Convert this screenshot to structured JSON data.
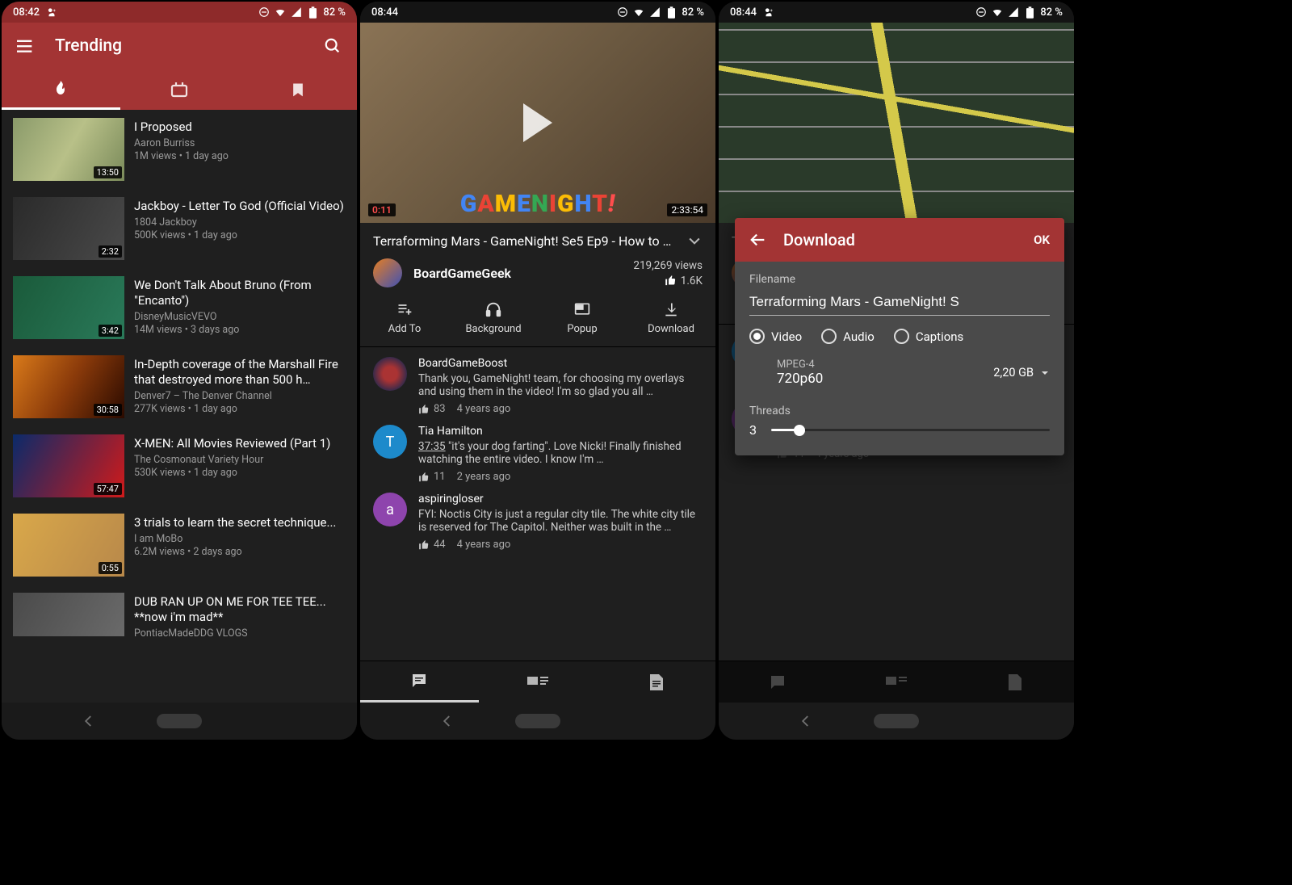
{
  "screens": {
    "s1": {
      "status": {
        "time": "08:42",
        "battery": "82 %"
      },
      "header": {
        "title": "Trending"
      },
      "tabs": [
        "trending",
        "subs",
        "bookmarks"
      ],
      "videos": [
        {
          "title": "I Proposed",
          "channel": "Aaron Burriss",
          "stats": "1M views • 1 day ago",
          "dur": "13:50"
        },
        {
          "title": "Jackboy - Letter To God (Official Video)",
          "channel": "1804 Jackboy",
          "stats": "500K views • 1 day ago",
          "dur": "2:32"
        },
        {
          "title": "We Don't Talk About Bruno (From \"Encanto\")",
          "channel": "DisneyMusicVEVO",
          "stats": "14M views • 3 days ago",
          "dur": "3:42"
        },
        {
          "title": "In-Depth coverage of the Marshall Fire that destroyed more than 500 h…",
          "channel": "Denver7 – The Denver Channel",
          "stats": "277K views • 1 day ago",
          "dur": "30:58"
        },
        {
          "title": "X-MEN: All Movies Reviewed (Part 1)",
          "channel": "The Cosmonaut Variety Hour",
          "stats": "530K views • 1 day ago",
          "dur": "57:47"
        },
        {
          "title": "3 trials to learn the secret technique...",
          "channel": "I am MoBo",
          "stats": "6.2M views • 2 days ago",
          "dur": "0:55"
        },
        {
          "title": "DUB RAN UP ON ME FOR TEE TEE... **now i'm mad**",
          "channel": "PontiacMadeDDG VLOGS",
          "stats": "",
          "dur": ""
        }
      ]
    },
    "s2": {
      "status": {
        "time": "08:44",
        "battery": "82 %"
      },
      "player": {
        "elapsed": "0:11",
        "total": "2:33:54",
        "overlay": "GameNight!"
      },
      "title": "Terraforming Mars - GameNight! Se5 Ep9 - How to …",
      "channel": {
        "name": "BoardGameGeek",
        "views": "219,269 views",
        "likes": "1.6K"
      },
      "actions": {
        "add": "Add To",
        "background": "Background",
        "popup": "Popup",
        "download": "Download"
      },
      "comments": [
        {
          "author": "BoardGameBoost",
          "text": "Thank you, GameNight! team, for choosing my overlays and using them in the video! I'm so glad you all …",
          "likes": "83",
          "age": "4 years ago",
          "avbg": "#3a2a4a",
          "initial": ""
        },
        {
          "author": "Tia Hamilton",
          "ts": "37:35",
          "text": "\"it's your dog farting\". Love Nicki!\nFinally finished watching the entire video. I know I'm …",
          "likes": "11",
          "age": "2 years ago",
          "avbg": "#1d8acb",
          "initial": "T"
        },
        {
          "author": "aspiringloser",
          "text": "FYI: Noctis City is just a regular city tile.  The white city tile is reserved for The Capitol.  Neither was built in the …",
          "likes": "44",
          "age": "4 years ago",
          "avbg": "#8e44ad",
          "initial": "a"
        }
      ]
    },
    "s3": {
      "status": {
        "time": "08:44",
        "battery": "82 %"
      },
      "dialog": {
        "title": "Download",
        "ok": "OK",
        "filename_label": "Filename",
        "filename": "Terraforming Mars - GameNight! S",
        "options": {
          "video": "Video",
          "audio": "Audio",
          "captions": "Captions"
        },
        "selected": "video",
        "format_codec": "MPEG-4",
        "format_res": "720p60",
        "format_size": "2,20 GB",
        "threads_label": "Threads",
        "threads": "3"
      }
    }
  }
}
